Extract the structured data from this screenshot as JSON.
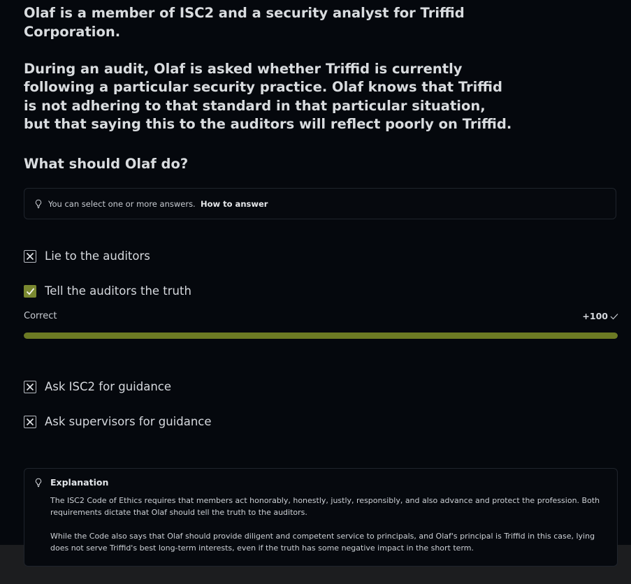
{
  "question": {
    "paragraph1": "Olaf is a member of ISC2 and a security analyst for Triffid Corporation.",
    "paragraph2": "During an audit, Olaf is asked whether Triffid is currently following a particular security practice. Olaf knows that Triffid is not adhering to that standard in that particular situation, but that saying this to the auditors will reflect poorly on Triffid.",
    "prompt": "What should Olaf do?"
  },
  "hint": {
    "icon": "lightbulb-icon",
    "text": "You can select one or more answers.",
    "link": "How to answer"
  },
  "options": [
    {
      "label": "Lie to the auditors",
      "state": "incorrect",
      "icon": "x-icon"
    },
    {
      "label": "Tell the auditors the truth",
      "state": "correct",
      "icon": "check-icon"
    },
    {
      "label": "Ask ISC2 for guidance",
      "state": "incorrect",
      "icon": "x-icon"
    },
    {
      "label": "Ask supervisors for guidance",
      "state": "incorrect",
      "icon": "x-icon"
    }
  ],
  "result": {
    "label": "Correct",
    "points": "+100",
    "progress_percent": 100,
    "accent_color": "#6c7a23"
  },
  "explanation": {
    "title": "Explanation",
    "paragraph1": "The ISC2 Code of Ethics requires that members act honorably, honestly, justly, responsibly, and also advance and protect the profession. Both requirements dictate that Olaf should tell the truth to the auditors.",
    "paragraph2": "While the Code also says that Olaf should provide diligent and competent service to principals, and Olaf's principal is Triffid in this case, lying does not serve Triffid's best long-term interests, even if the truth has some negative impact in the short term."
  }
}
